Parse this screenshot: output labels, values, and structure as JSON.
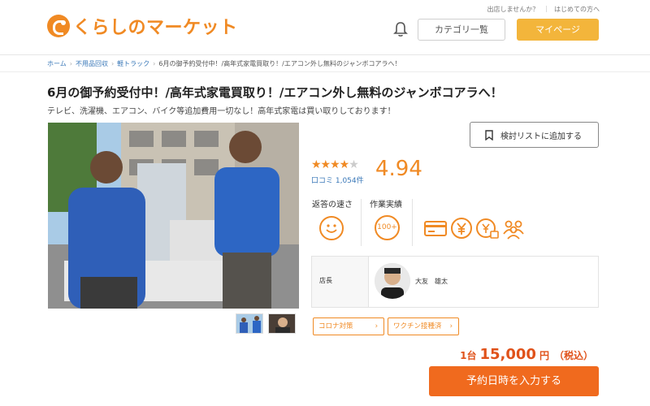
{
  "header": {
    "logo_text": "くらしのマーケット",
    "top_links": [
      "出店しませんか？",
      "はじめての方へ"
    ],
    "category_button": "カテゴリ一覧",
    "mypage_button": "マイページ"
  },
  "breadcrumb": [
    "ホーム",
    "不用品回収",
    "軽トラック",
    "6月の御予約受付中！/高年式家電買取り！/エアコン外し無料のジャンボコアラへ！"
  ],
  "listing": {
    "title": "6月の御予約受付中！/高年式家電買取り！/エアコン外し無料のジャンボコアラへ！",
    "subtitle": "テレビ、洗濯機、エアコン、バイク等追加費用一切なし！高年式家電は買い取りしております！",
    "watch_button": "検討リストに追加する",
    "stars": "★★★★",
    "star_empty": "★",
    "rating_out_of_5": 4.94,
    "rating": "4.94",
    "reviews": "口コミ 1,054件",
    "stats": {
      "response_label": "返答の速さ",
      "work_label": "作業実績",
      "work_badge": "100+"
    },
    "staff": {
      "label": "店長",
      "name": "大友　雄太"
    },
    "tags": [
      "コロナ対策",
      "ワクチン接種済"
    ],
    "price": {
      "unit": "1台",
      "amount": "15,000",
      "yen": "円",
      "tax": "（税込）"
    },
    "book_button": "予約日時を入力する"
  },
  "colors": {
    "brand": "#f08a24",
    "mypage": "#f3b53b",
    "book": "#f06a1e",
    "price": "#e0521a",
    "link": "#3a78b8"
  }
}
